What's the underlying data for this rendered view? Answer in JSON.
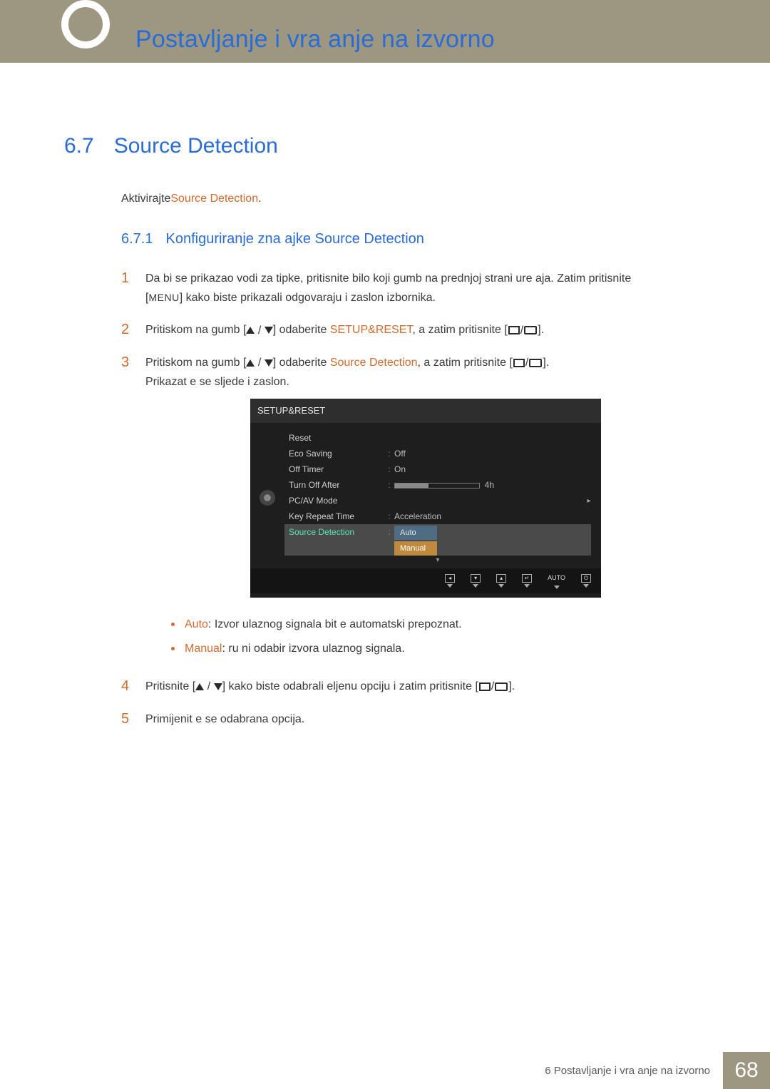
{
  "header": {
    "page_title": "Postavljanje i vra  anje na izvorno"
  },
  "section": {
    "num": "6.7",
    "title": "Source Detection"
  },
  "intro": {
    "prefix": "Aktivirajte",
    "hl": "Source Detection",
    "suffix": "."
  },
  "subsection": {
    "num": "6.7.1",
    "title": "Konfiguriranje zna  ajke Source Detection"
  },
  "steps": {
    "s1": {
      "num": "1",
      "line1": "Da bi se prikazao vodi   za tipke, pritisnite bilo koji gumb na prednjoj strani ure aja. Zatim pritisnite",
      "line2_pre": "[",
      "menu": "MENU",
      "line2_post": "] kako biste prikazali odgovaraju i zaslon izbornika."
    },
    "s2": {
      "num": "2",
      "pre": "Pritiskom na gumb [",
      "mid": "] odaberite ",
      "hl": "SETUP&RESET",
      "post1": ", a zatim pritisnite [",
      "post2": "]."
    },
    "s3": {
      "num": "3",
      "pre": "Pritiskom na gumb [",
      "mid": "] odaberite ",
      "hl": "Source Detection",
      "post1": ", a zatim pritisnite [",
      "post2": "].",
      "extra": "Prikazat  e se sljede i zaslon."
    },
    "s4": {
      "num": "4",
      "pre": "Pritisnite [",
      "mid": "] kako biste odabrali  eljenu opciju i zatim pritisnite [",
      "post": "]."
    },
    "s5": {
      "num": "5",
      "text": "Primijenit  e se odabrana opcija."
    }
  },
  "osd": {
    "title": "SETUP&RESET",
    "rows": {
      "reset": "Reset",
      "eco": "Eco Saving",
      "eco_val": "Off",
      "offtimer": "Off Timer",
      "offtimer_val": "On",
      "turnoff": "Turn Off After",
      "turnoff_val": "4h",
      "pcav": "PC/AV Mode",
      "keyrep": "Key Repeat Time",
      "keyrep_val": "Acceleration",
      "srcdet": "Source Detection",
      "srcdet_val1": "Auto",
      "srcdet_val2": "Manual"
    },
    "footer": {
      "auto": "AUTO"
    }
  },
  "bullets": {
    "b1_hl": "Auto",
    "b1_text": ": Izvor ulaznog signala bit e automatski prepoznat.",
    "b2_hl": "Manual",
    "b2_text": ": ru ni odabir izvora ulaznog signala."
  },
  "footer": {
    "label": "6 Postavljanje i vra  anje na izvorno",
    "page": "68"
  }
}
